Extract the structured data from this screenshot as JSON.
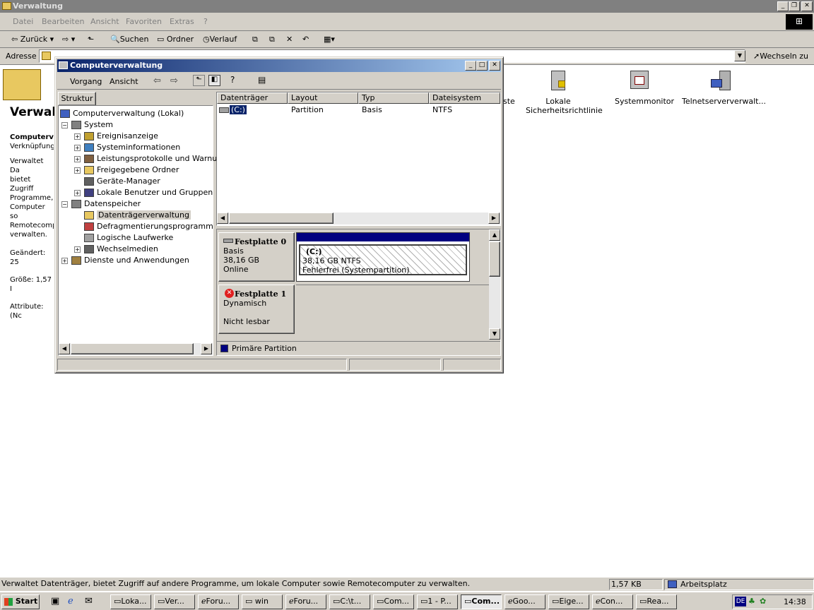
{
  "explorer": {
    "title": "Verwaltung",
    "menu": [
      "Datei",
      "Bearbeiten",
      "Ansicht",
      "Favoriten",
      "Extras",
      "?"
    ],
    "toolbar": {
      "back": "Zurück",
      "search": "Suchen",
      "folders": "Ordner",
      "history": "Verlauf"
    },
    "address_label": "Adresse",
    "go_label": "Wechseln zu",
    "left_heading": "Verwalt",
    "left_info": [
      "Computerv",
      "Verknüpfung",
      "Verwaltet Da",
      "bietet Zugriff",
      "Programme,",
      "Computer so",
      "Remotecomp",
      "verwalten.",
      "Geändert: 25",
      "Größe: 1,57 I",
      "Attribute: (Nc"
    ],
    "icons": [
      {
        "label_line1": "ste",
        "label_line2": ""
      },
      {
        "label_line1": "Lokale",
        "label_line2": "Sicherheitsrichtlinie"
      },
      {
        "label_line1": "Systemmonitor",
        "label_line2": ""
      },
      {
        "label_line1": "Telnetserververwalt...",
        "label_line2": ""
      }
    ],
    "status": {
      "text": "Verwaltet Datenträger, bietet Zugriff auf andere Programme, um lokale Computer sowie Remotecomputer zu verwalten.",
      "size": "1,57 KB",
      "zone": "Arbeitsplatz"
    }
  },
  "mmc": {
    "title": "Computerverwaltung",
    "menu": {
      "action": "Vorgang",
      "view": "Ansicht"
    },
    "tree_tab": "Struktur",
    "tree": [
      {
        "label": "Computerverwaltung (Lokal)",
        "level": 0,
        "expander": ""
      },
      {
        "label": "System",
        "level": 1,
        "expander": "-"
      },
      {
        "label": "Ereignisanzeige",
        "level": 2,
        "expander": "+"
      },
      {
        "label": "Systeminformationen",
        "level": 2,
        "expander": "+"
      },
      {
        "label": "Leistungsprotokolle und Warnung",
        "level": 2,
        "expander": "+"
      },
      {
        "label": "Freigegebene Ordner",
        "level": 2,
        "expander": "+"
      },
      {
        "label": "Geräte-Manager",
        "level": 2,
        "expander": ""
      },
      {
        "label": "Lokale Benutzer und Gruppen",
        "level": 2,
        "expander": "+"
      },
      {
        "label": "Datenspeicher",
        "level": 1,
        "expander": "-"
      },
      {
        "label": "Datenträgerverwaltung",
        "level": 2,
        "expander": ""
      },
      {
        "label": "Defragmentierungsprogramm",
        "level": 2,
        "expander": ""
      },
      {
        "label": "Logische Laufwerke",
        "level": 2,
        "expander": ""
      },
      {
        "label": "Wechselmedien",
        "level": 2,
        "expander": "+"
      },
      {
        "label": "Dienste und Anwendungen",
        "level": 1,
        "expander": "+"
      }
    ],
    "columns": [
      "Datenträger",
      "Layout",
      "Typ",
      "Dateisystem"
    ],
    "volumes": [
      {
        "name": "(C:)",
        "layout": "Partition",
        "type": "Basis",
        "fs": "NTFS"
      }
    ],
    "disks": [
      {
        "name": "Festplatte 0",
        "type": "Basis",
        "size": "38,16 GB",
        "state": "Online",
        "partition": {
          "name": "(C:)",
          "info": "38,16 GB NTFS",
          "status": "Fehlerfrei (Systempartition)"
        }
      },
      {
        "name": "Festplatte 1",
        "type": "Dynamisch",
        "size": "",
        "state": "Nicht lesbar"
      }
    ],
    "legend": "Primäre Partition"
  },
  "taskbar": {
    "start": "Start",
    "tasks": [
      "Loka...",
      "Ver...",
      "Foru...",
      "win",
      "Foru...",
      "C:\\t...",
      "Com...",
      "1 - P...",
      "Com...",
      "Goo...",
      "Eige...",
      "Con...",
      "Rea..."
    ],
    "lang": "DE",
    "clock": "14:38"
  },
  "colors": {
    "titlebar_active": "#0a246a",
    "titlebar_inactive": "#808080",
    "face": "#d4d0c8",
    "primary_partition": "#000080"
  }
}
